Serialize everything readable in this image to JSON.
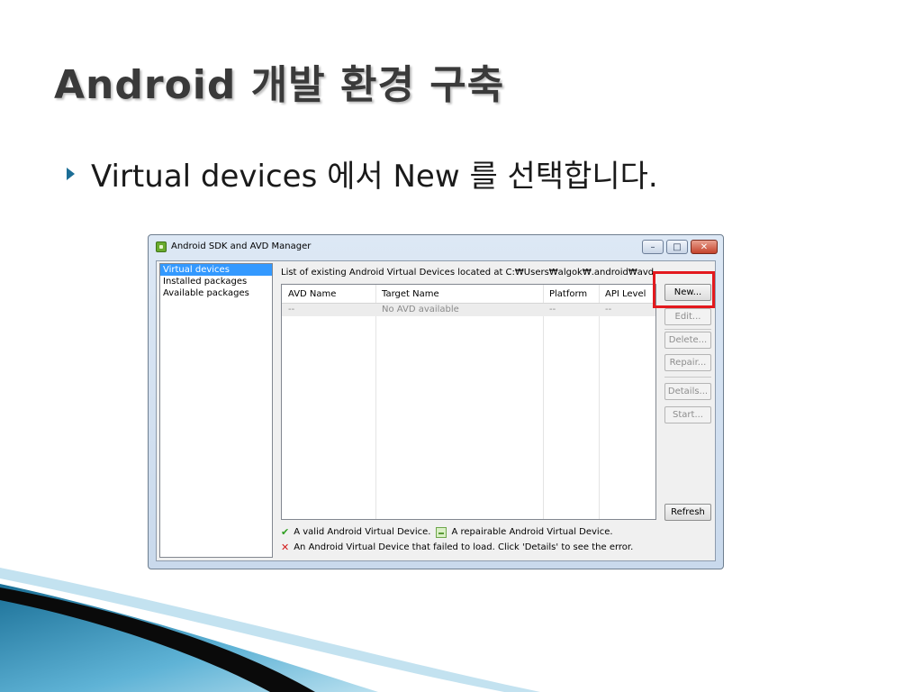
{
  "slide": {
    "title": "Android 개발 환경 구축",
    "bullet": "Virtual devices 에서 New 를 선택합니다."
  },
  "window": {
    "title": "Android SDK and AVD Manager",
    "controls": {
      "minimize": "–",
      "maximize": "□",
      "close": "✕"
    },
    "sidebar": {
      "items": [
        "Virtual devices",
        "Installed packages",
        "Available packages"
      ],
      "selected_index": 0
    },
    "list_label": "List of existing Android Virtual Devices located at C:₩Users₩algok₩.android₩avd",
    "table": {
      "columns": [
        "AVD Name",
        "Target Name",
        "Platform",
        "API Level"
      ],
      "rows": [
        [
          "--",
          "No AVD available",
          "--",
          "--"
        ]
      ]
    },
    "buttons": {
      "new": "New...",
      "edit": "Edit...",
      "delete": "Delete...",
      "repair": "Repair...",
      "details": "Details...",
      "start": "Start...",
      "refresh": "Refresh"
    },
    "legend": {
      "valid": "A valid Android Virtual Device.",
      "repairable": "A repairable Android Virtual Device.",
      "failed": "An Android Virtual Device that failed to load. Click 'Details' to see the error."
    }
  },
  "colors": {
    "highlight": "#e3191e",
    "selection": "#3399ff",
    "bullet": "#1c6e96"
  }
}
